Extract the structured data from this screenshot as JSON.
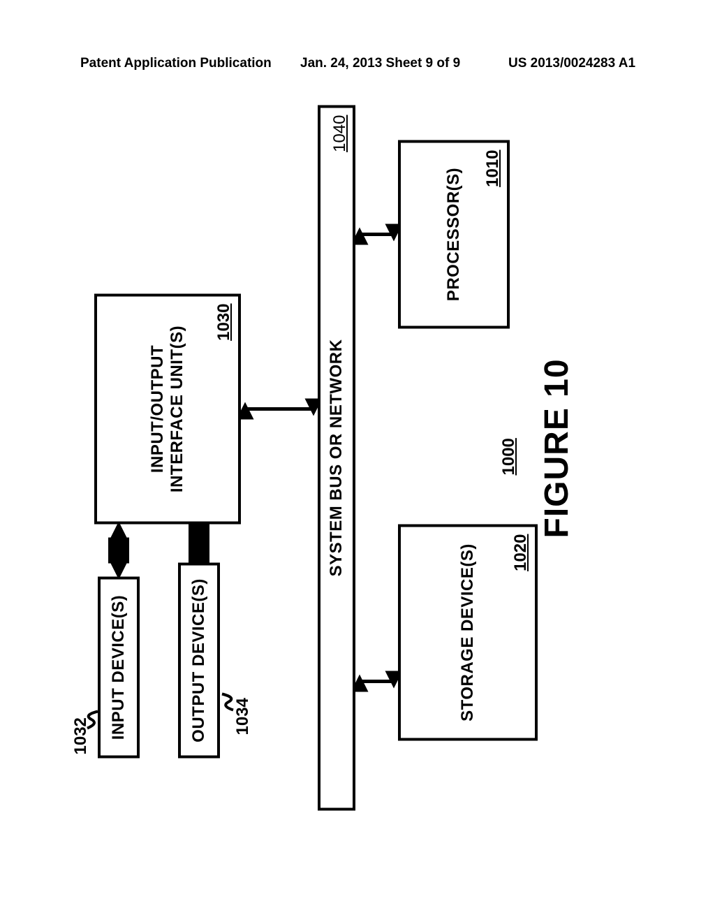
{
  "header": {
    "left": "Patent Application Publication",
    "mid": "Jan. 24, 2013  Sheet 9 of 9",
    "right": "US 2013/0024283 A1"
  },
  "blocks": {
    "input_device": {
      "label": "INPUT DEVICE(S)",
      "ref": "1032"
    },
    "output_device": {
      "label": "OUTPUT DEVICE(S)",
      "ref": "1034"
    },
    "io_interface": {
      "label1": "INPUT/OUTPUT",
      "label2": "INTERFACE UNIT(S)",
      "ref": "1030"
    },
    "bus": {
      "label": "SYSTEM BUS OR NETWORK",
      "ref": "1040"
    },
    "storage": {
      "label": "STORAGE DEVICE(S)",
      "ref": "1020"
    },
    "processor": {
      "label": "PROCESSOR(S)",
      "ref": "1010"
    }
  },
  "figure": {
    "title": "FIGURE 10",
    "ref": "1000"
  }
}
